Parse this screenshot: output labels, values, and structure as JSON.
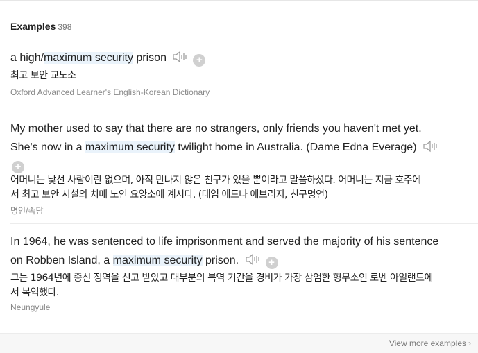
{
  "header": {
    "title": "Examples",
    "count": "398"
  },
  "examples": [
    {
      "en_before": "a high/",
      "en_highlight": "maximum security",
      "en_after": " prison",
      "ko": "최고 보안 교도소",
      "source": "Oxford Advanced Learner's English-Korean Dictionary"
    },
    {
      "en_line1": "My mother used to say that there are no strangers, only friends you haven't met yet.",
      "en_before": "She's now in a ",
      "en_highlight": "maximum security",
      "en_after": " twilight home in Australia. (Dame Edna Everage)",
      "ko_line1": "어머니는 낯선 사람이란 없으며, 아직 만나지 않은 친구가 있을 뿐이라고 말씀하셨다. 어머니는 지금 호주에",
      "ko_line2": "서 최고 보안 시설의 치매 노인 요양소에 계시다. (데임 에드나 에브리지, 친구명언)",
      "source": "명언/속담"
    },
    {
      "en_line1": "In 1964, he was sentenced to life imprisonment and served the majority of his sentence",
      "en_before": "on Robben Island, a ",
      "en_highlight": "maximum security",
      "en_after": " prison.",
      "ko_line1": "그는 1964년에 종신 징역을 선고 받았고 대부분의 복역 기간을 경비가 가장 삼엄한 형무소인 로벤 아일랜드에",
      "ko_line2": "서 복역했다.",
      "source": "Neungyule"
    }
  ],
  "footer": {
    "more_label": "View more examples",
    "chevron": "›"
  },
  "icons": {
    "speaker": "speaker-icon",
    "add": "add-icon"
  },
  "colors": {
    "highlight": "#eaf3fb",
    "icon_gray": "#d0d0d0",
    "source_text": "#888888"
  }
}
